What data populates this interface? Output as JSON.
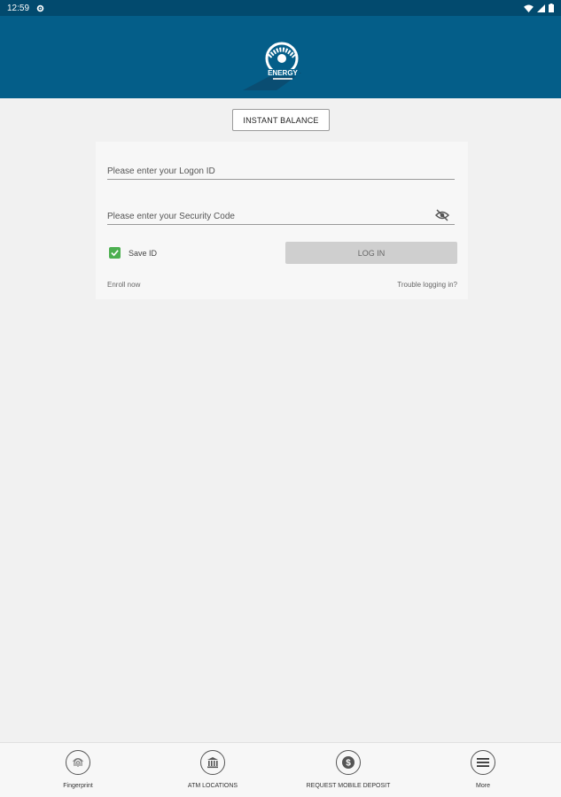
{
  "status_bar": {
    "time": "12:59"
  },
  "header": {
    "logo_alt": "ENERGY"
  },
  "instant_balance": {
    "label": "INSTANT BALANCE"
  },
  "login_form": {
    "logon_placeholder": "Please enter your Logon ID",
    "code_placeholder": "Please enter your Security Code",
    "save_id_label": "Save ID",
    "save_id_checked": true,
    "login_label": "LOG IN",
    "enroll_label": "Enroll now",
    "trouble_label": "Trouble logging in?"
  },
  "bottom_nav": {
    "items": [
      {
        "label": "Fingerprint",
        "icon": "fingerprint-icon"
      },
      {
        "label": "ATM LOCATIONS",
        "icon": "bank-icon"
      },
      {
        "label": "REQUEST MOBILE DEPOSIT",
        "icon": "dollar-icon"
      },
      {
        "label": "More",
        "icon": "menu-icon"
      }
    ]
  },
  "colors": {
    "header": "#045e89",
    "status_bar": "#024a6e",
    "checkbox": "#4caf50",
    "background": "#f1f1f1"
  }
}
